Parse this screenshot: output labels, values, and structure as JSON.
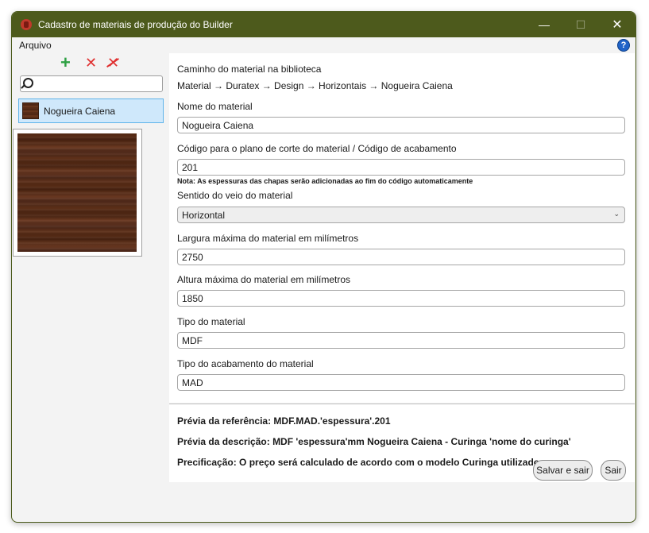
{
  "window": {
    "title": "Cadastro de materiais de produção do Builder"
  },
  "menu": {
    "file": "Arquivo"
  },
  "left": {
    "search_value": "",
    "items": [
      {
        "label": "Nogueira Caiena"
      }
    ]
  },
  "form": {
    "path_label": "Caminho do material na biblioteca",
    "path_value": "Material → Duratex → Design → Horizontais → Nogueira Caiena",
    "name_label": "Nome do material",
    "name_value": "Nogueira Caiena",
    "code_label": "Código para o plano de corte do material / Código de acabamento",
    "code_value": "201",
    "code_note": "Nota: As espessuras das chapas serão adicionadas ao fim do código automaticamente",
    "grain_label": "Sentido do veio do material",
    "grain_value": "Horizontal",
    "width_label": "Largura máxima do material em milímetros",
    "width_value": "2750",
    "height_label": "Altura máxima do material em milímetros",
    "height_value": "1850",
    "type_label": "Tipo do material",
    "type_value": "MDF",
    "finish_label": "Tipo do acabamento do material",
    "finish_value": "MAD"
  },
  "preview": {
    "reference": "Prévia da referência: MDF.MAD.'espessura'.201",
    "description": "Prévia da descrição: MDF 'espessura'mm Nogueira Caiena - Curinga 'nome do curinga'",
    "pricing": "Precificação: O preço será calculado de acordo com o modelo Curinga utilizado"
  },
  "buttons": {
    "save_exit": "Salvar e sair",
    "exit": "Sair"
  },
  "icons": {
    "app": "builder-app-icon",
    "help": "help-icon",
    "add": "add-icon",
    "delete": "delete-icon",
    "delete_all": "delete-all-icon",
    "search": "search-icon",
    "dropdown": "chevron-down-icon",
    "help_glyph": "?",
    "minimize_glyph": "—",
    "maximize_glyph": "☐",
    "close_glyph": "✕",
    "add_glyph": "+",
    "delete_glyph": "✕",
    "delete_all_glyph": "✕",
    "dropdown_glyph": "⌄"
  },
  "colors": {
    "titlebar": "#4d5a1c",
    "selection": "#cfe8fb",
    "add": "#2ea043",
    "delete": "#e03030",
    "help": "#1f63c8"
  }
}
